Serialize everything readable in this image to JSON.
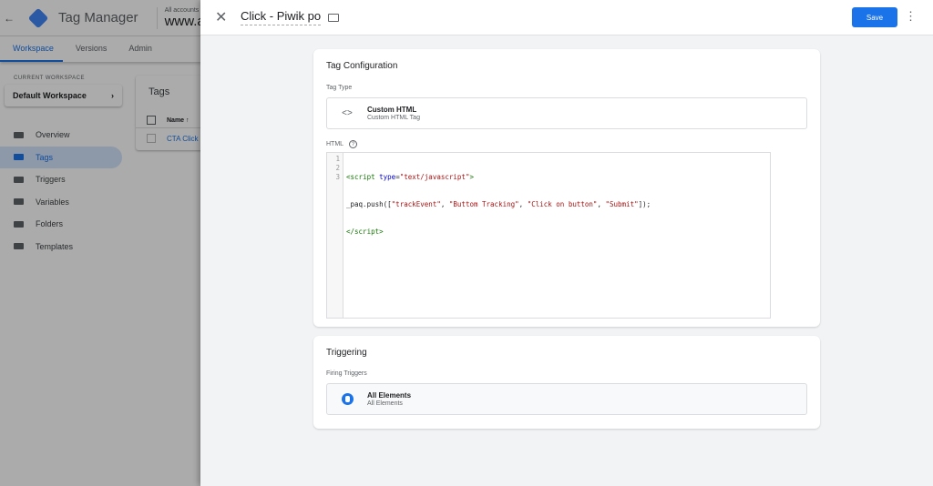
{
  "app": {
    "name": "Tag Manager",
    "breadcrumb": "All accounts > Ana",
    "container": "www.analy"
  },
  "nav": [
    "Workspace",
    "Versions",
    "Admin"
  ],
  "workspace": {
    "label": "CURRENT WORKSPACE",
    "name": "Default Workspace",
    "chevron": "›"
  },
  "sidebar": [
    {
      "label": "Overview",
      "icon": "overview-icon"
    },
    {
      "label": "Tags",
      "icon": "tag-icon"
    },
    {
      "label": "Triggers",
      "icon": "trigger-icon"
    },
    {
      "label": "Variables",
      "icon": "variables-icon"
    },
    {
      "label": "Folders",
      "icon": "folder-icon"
    },
    {
      "label": "Templates",
      "icon": "templates-icon"
    }
  ],
  "tags_card": {
    "title": "Tags",
    "col": "Name ↑",
    "row": "CTA Click"
  },
  "panel": {
    "title": "Click - Piwik po",
    "save": "Save",
    "more": "⋮",
    "close": "✕",
    "config": {
      "title": "Tag Configuration",
      "type_label": "Tag Type",
      "type_name": "Custom HTML",
      "type_sub": "Custom HTML Tag",
      "type_icon": "<>",
      "html_label": "HTML",
      "help": "?"
    },
    "code": {
      "lines": [
        "1",
        "2",
        "3"
      ],
      "l1a": "<script ",
      "l1b": "type",
      "l1c": "=",
      "l1d": "\"text/javascript\"",
      "l1e": ">",
      "l2a": "_paq.push([",
      "l2b": "\"trackEvent\"",
      "l2c": ", ",
      "l2d": "\"Buttom Tracking\"",
      "l2e": ", ",
      "l2f": "\"Click on button\"",
      "l2g": ", ",
      "l2h": "\"Submit\"",
      "l2i": "]);",
      "l3": "</script>"
    },
    "triggering": {
      "title": "Triggering",
      "label": "Firing Triggers",
      "name": "All Elements",
      "sub": "All Elements"
    }
  },
  "colors": {
    "accent": "#1a73e8"
  }
}
